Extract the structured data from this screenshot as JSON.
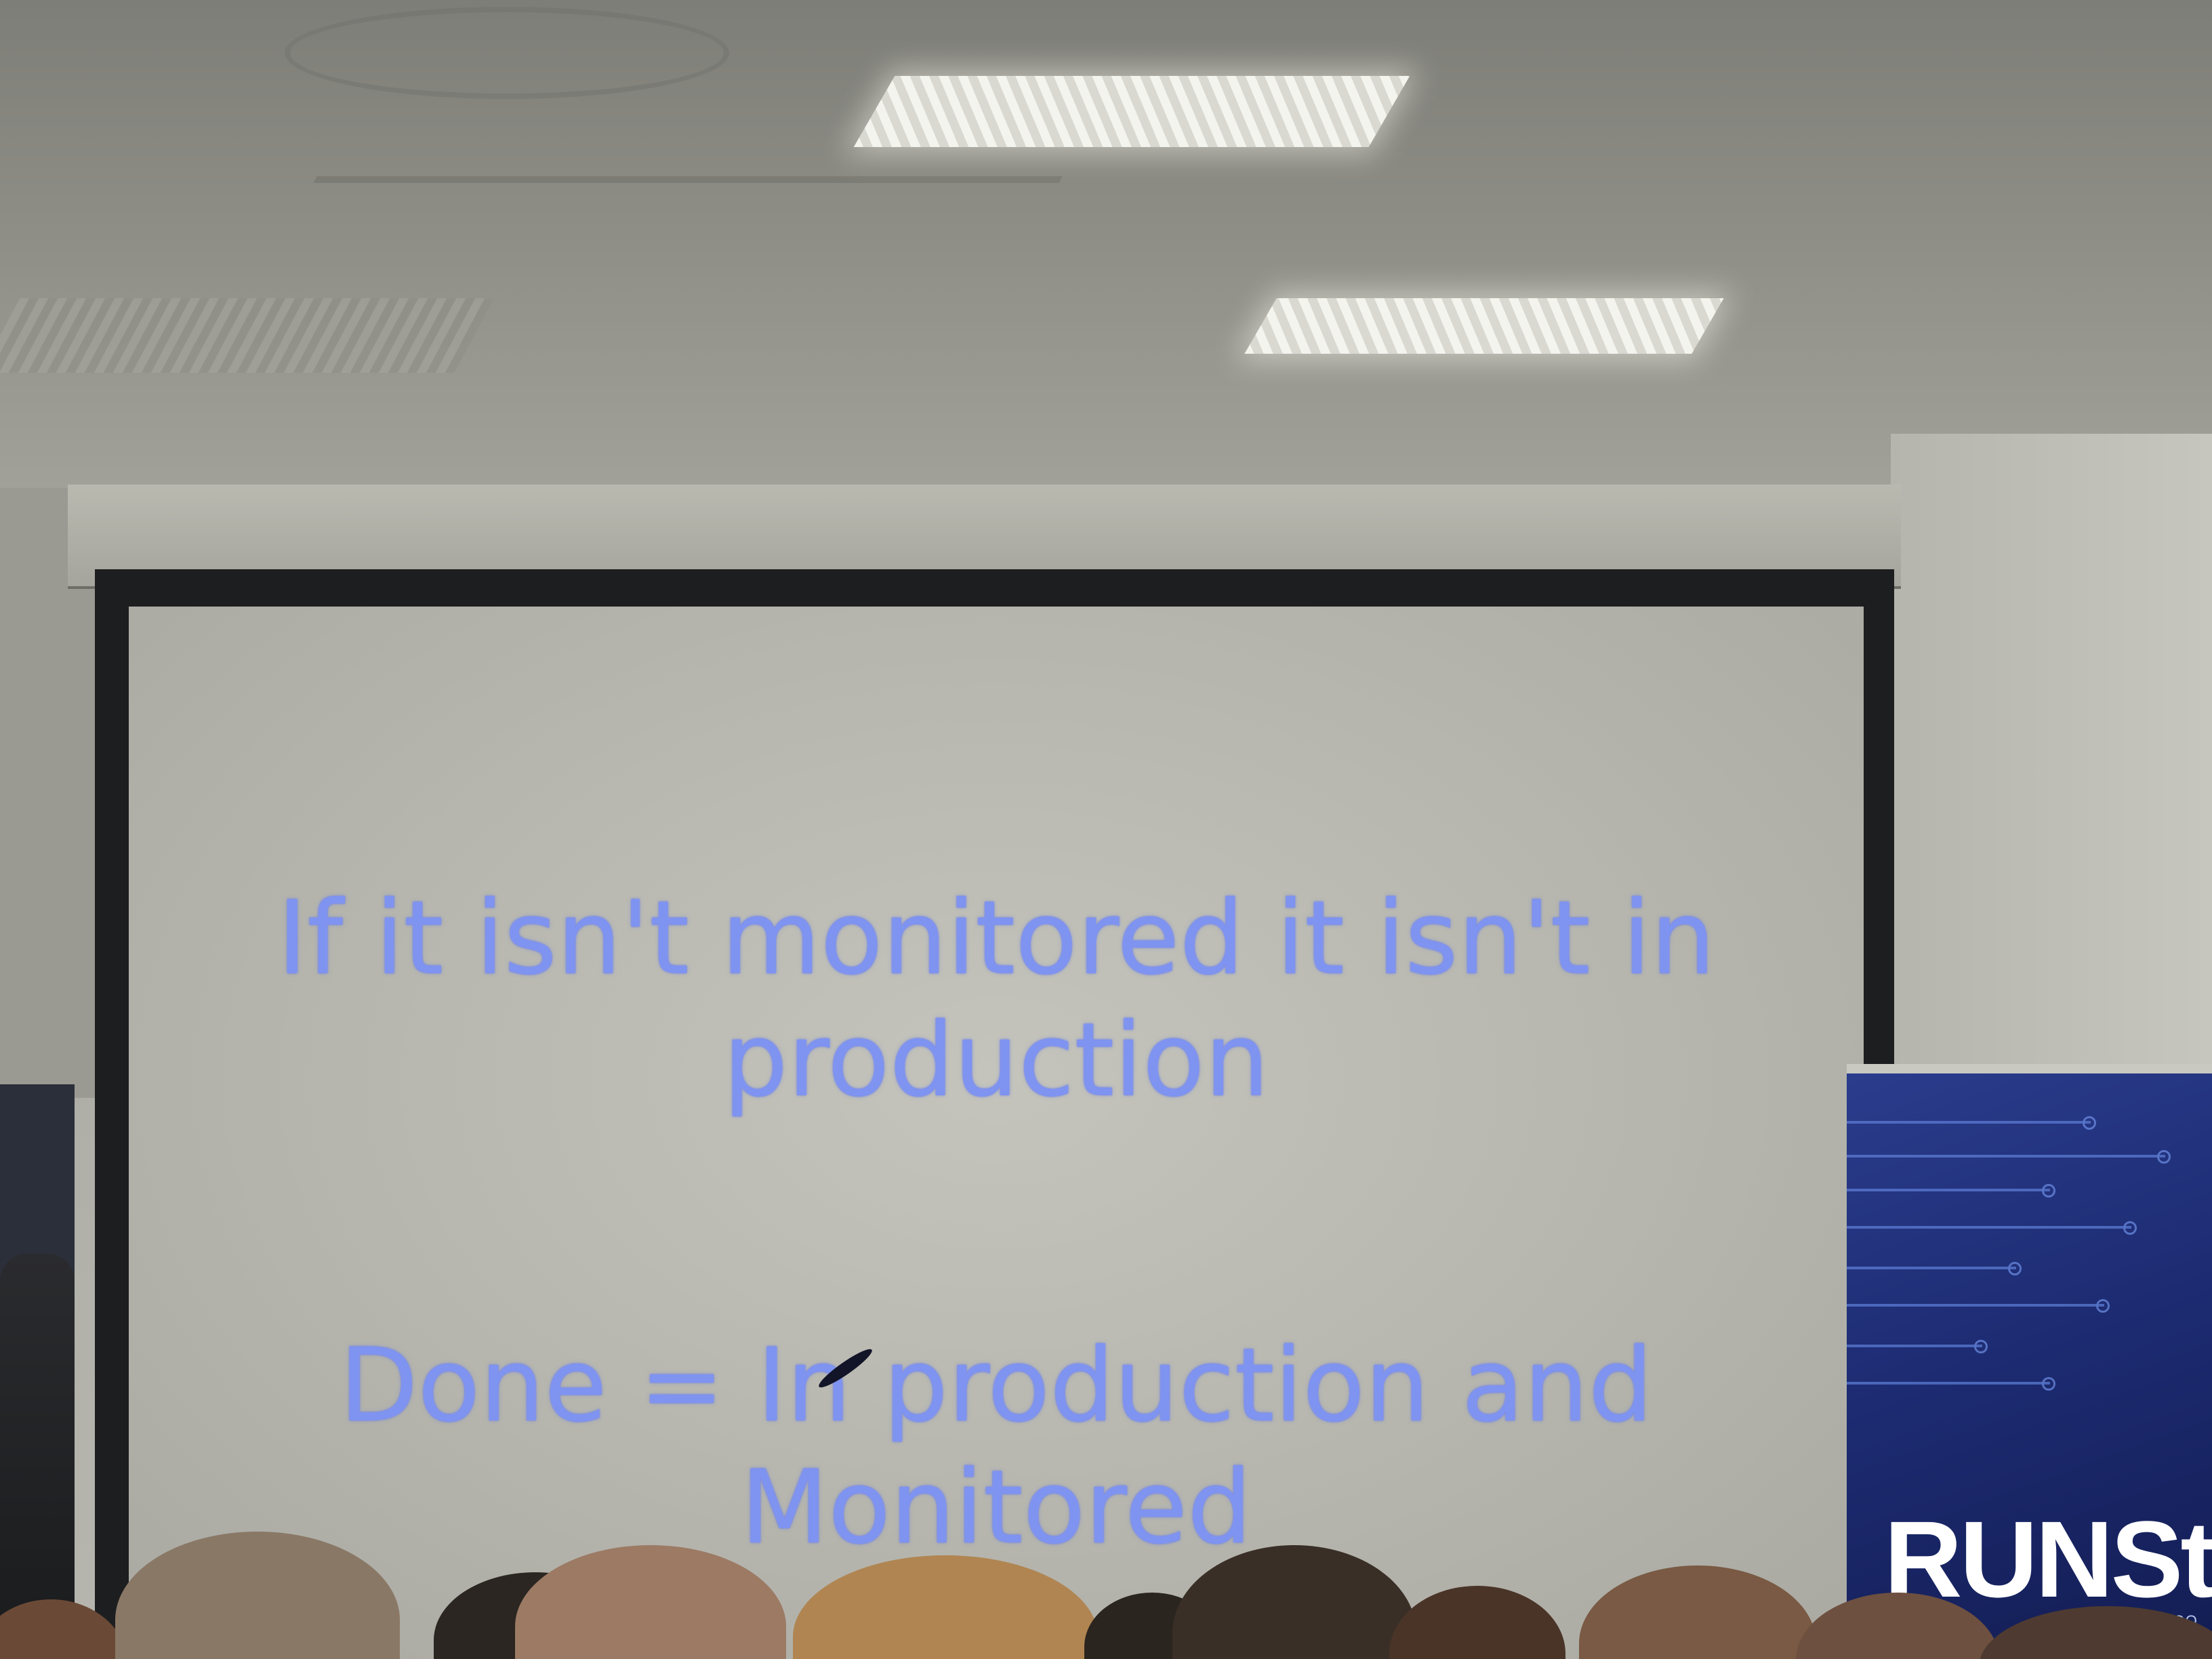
{
  "slide": {
    "line_1": "If it isn't monitored it isn't in production",
    "line_2": "Done = In production and Monitored"
  },
  "banner": {
    "brand": "RUNSt",
    "subtitle": "DEVOPS CO"
  },
  "colors": {
    "slide_text": "#7f93f0",
    "banner_background": "#1c2a70",
    "screen_surface": "#b7b7af"
  }
}
